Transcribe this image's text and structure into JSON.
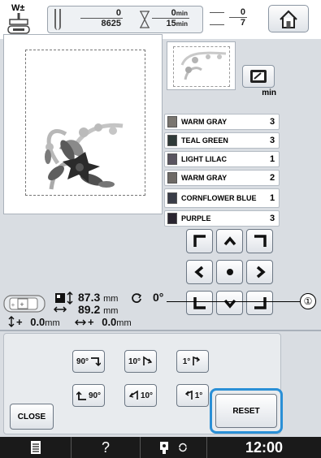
{
  "topbar": {
    "presser_foot_label": "W±",
    "stitch_count": "0",
    "stitch_total": "8625",
    "time_elapsed": "0",
    "time_unit_top": "min",
    "time_total": "15",
    "time_unit_bottom": "min",
    "color_current": "0",
    "color_total": "7",
    "home_icon": "home-icon"
  },
  "thread_colors": {
    "header_unit": "min",
    "items": [
      {
        "name": "WARM GRAY",
        "minutes": "3",
        "color": "#7a7670"
      },
      {
        "name": "TEAL GREEN",
        "minutes": "3",
        "color": "#2f3a38"
      },
      {
        "name": "LIGHT LILAC",
        "minutes": "1",
        "color": "#5a5560"
      },
      {
        "name": "WARM GRAY",
        "minutes": "2",
        "color": "#6e6a66"
      },
      {
        "name": "CORNFLOWER BLUE",
        "minutes": "1",
        "color": "#3a3d48"
      },
      {
        "name": "PURPLE",
        "minutes": "3",
        "color": "#2a2530"
      }
    ]
  },
  "info": {
    "height_value": "87.3",
    "height_unit": "mm",
    "width_value": "89.2",
    "width_unit": "mm",
    "angle_value": "0",
    "angle_unit": "°",
    "v_offset_prefix": "+",
    "v_offset_value": "0.0",
    "v_offset_unit": "mm",
    "h_offset_prefix": "+",
    "h_offset_value": "0.0",
    "h_offset_unit": "mm"
  },
  "callout": "①",
  "rotate_buttons": [
    {
      "label": "90°",
      "icon": "rotate-right-90-icon"
    },
    {
      "label": "10°",
      "icon": "rotate-right-10-icon"
    },
    {
      "label": "1°",
      "icon": "rotate-right-1-icon"
    },
    {
      "label": "90°",
      "icon": "rotate-left-90-icon"
    },
    {
      "label": "10°",
      "icon": "rotate-left-10-icon"
    },
    {
      "label": "1°",
      "icon": "rotate-left-1-icon"
    }
  ],
  "buttons": {
    "close": "CLOSE",
    "reset": "RESET"
  },
  "bottombar": {
    "help": "?",
    "clock": "12:00"
  },
  "colors": {
    "panel": "#d9dde2",
    "highlight": "#2a8fd6",
    "bottombar": "#1a1a1a"
  }
}
